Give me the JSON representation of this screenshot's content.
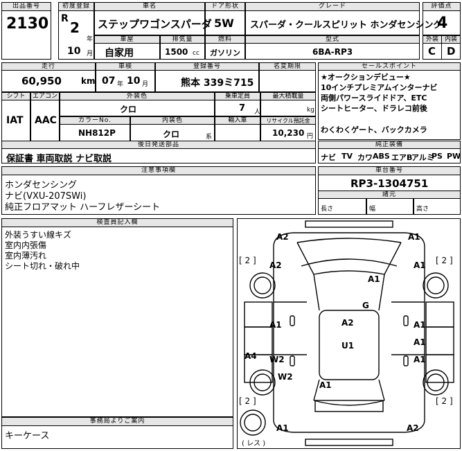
{
  "labels": {
    "lot_no": "出品番号",
    "first_reg": "初度登録",
    "car_name": "車名",
    "door": "ドア形状",
    "grade": "グレード",
    "score": "評価点",
    "year_unit": "年",
    "month_unit": "月",
    "body_type": "車屋",
    "displacement": "排気量",
    "fuel": "燃料",
    "model": "型式",
    "exterior": "外装",
    "interior": "内装",
    "mileage": "走行",
    "inspection": "車検",
    "reg_no": "登録番号",
    "expiry": "名変期限",
    "shift": "シフト",
    "ac": "エアコン",
    "ext_color": "外装色",
    "capacity": "乗車定員",
    "max_load": "最大積載量",
    "color_no": "カラーNo.",
    "int_color": "内装色",
    "import": "輸入車",
    "recycle": "リサイクル預託金",
    "documents": "後日発送部品",
    "sales_points": "セールスポイント",
    "equipment": "純正装備",
    "notes": "注意事項欄",
    "chassis_no": "車台番号",
    "dims": "諸元",
    "length": "長さ",
    "width": "幅",
    "height": "高さ",
    "inspector": "検査員記入欄",
    "office": "事務局よりご案内"
  },
  "vehicle": {
    "lot_no": "2130",
    "era": "R",
    "year": "2",
    "month": "10",
    "name": "ステップワゴンスパーダ",
    "door": "5W",
    "grade": "スパーダ・クールスピリット ホンダセンシング",
    "score": "4",
    "use": "自家用",
    "displacement": "1500",
    "displacement_unit": "cc",
    "fuel": "ガソリン",
    "model": "6BA-RP3",
    "exterior_grade": "C",
    "interior_grade": "D",
    "mileage": "60,950",
    "mileage_unit": "km",
    "inspection_year": "07",
    "inspection_month": "10",
    "reg_no": "熊本 339ミ715",
    "shift": "IAT",
    "ac": "AAC",
    "ext_color": "クロ",
    "capacity": "7",
    "capacity_unit": "人",
    "load_unit": "kg",
    "color_no": "NH812P",
    "int_color": "クロ",
    "int_color_unit": "系",
    "recycle": "10,230",
    "recycle_unit": "円",
    "documents": "保証書 車両取説 ナビ取説",
    "chassis_no": "RP3-1304751"
  },
  "sales_points": [
    "★オークションデビュー★",
    "10インチプレミアムインターナビ",
    "両側パワースライドドア、ETC",
    "シートヒーター、ドラレコ前後",
    "",
    "わくわくゲート、バックカメラ"
  ],
  "equipment": [
    "ナビ",
    "TV",
    "カワ",
    "ABS",
    "エアB",
    "アルミ",
    "PS",
    "PW"
  ],
  "notes": [
    "ホンダセンシング",
    "ナビ(VXU-207SWi)",
    "純正フロアマット ハーフレザーシート"
  ],
  "inspector_notes": [
    "外装うすい線キズ",
    "室内内張傷",
    "室内薄汚れ",
    "シート切れ・破れ中"
  ],
  "office_note": "キーケース",
  "diagram_marks": [
    "A2",
    "A1",
    "A2",
    "A1",
    "A1",
    "G",
    "A1",
    "A2",
    "A1",
    "A1",
    "U1",
    "A4",
    "W2",
    "A1",
    "W2",
    "A1",
    "A1",
    "A2"
  ],
  "tire_marks": [
    "[ 2 ]",
    "[ 2 ]",
    "[ 2 ]",
    "[ 2 ]",
    "( レス )"
  ]
}
